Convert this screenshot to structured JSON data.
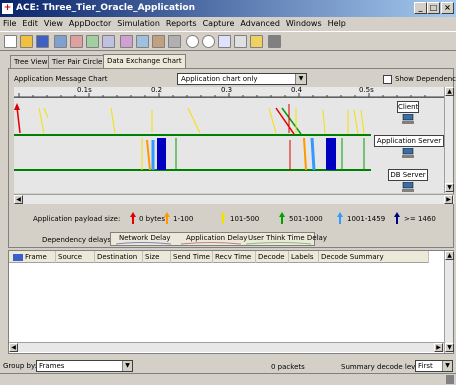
{
  "window": {
    "title": "ACE: Three_Tier_Oracle_Application",
    "minimize": "_",
    "maximize": "□",
    "close": "×"
  },
  "menu": [
    "File",
    "Edit",
    "View",
    "AppDoctor",
    "Simulation",
    "Reports",
    "Capture",
    "Advanced",
    "Windows",
    "Help"
  ],
  "tabs": [
    {
      "label": "Tree View"
    },
    {
      "label": "Tier Pair Circle"
    },
    {
      "label": "Data Exchange Chart"
    }
  ],
  "chart_header": {
    "label": "Application Message Chart",
    "select_value": "Application chart only",
    "show_dependencies_label": "Show Dependencies"
  },
  "ruler": {
    "ticks": [
      "0.1s",
      "0.2",
      "0.3",
      "0.4",
      "0.5s"
    ]
  },
  "tiers": [
    "Client",
    "Application Server",
    "DB Server"
  ],
  "legend": {
    "payload_label": "Application payload size:",
    "payload_items": [
      {
        "label": "0 bytes",
        "color": "#e00000"
      },
      {
        "label": "1-100",
        "color": "#ff9900"
      },
      {
        "label": "101-500",
        "color": "#f2e200"
      },
      {
        "label": "501-1000",
        "color": "#00a000"
      },
      {
        "label": "1001-1459",
        "color": "#3399ff"
      },
      {
        "label": ">= 1460",
        "color": "#000080"
      }
    ],
    "delay_label": "Dependency delays:",
    "delay_items": [
      "Network Delay",
      "Application Delay",
      "User Think Time Delay"
    ]
  },
  "table": {
    "columns": [
      "Frame",
      "Source",
      "Destination",
      "Size",
      "Send Time",
      "Recv Time",
      "Decode",
      "Labels",
      "Decode Summary"
    ]
  },
  "status": {
    "group_by_label": "Group by:",
    "group_by_value": "Frames",
    "packets": "0 packets",
    "summary_label": "Summary decode level",
    "summary_value": "First"
  }
}
